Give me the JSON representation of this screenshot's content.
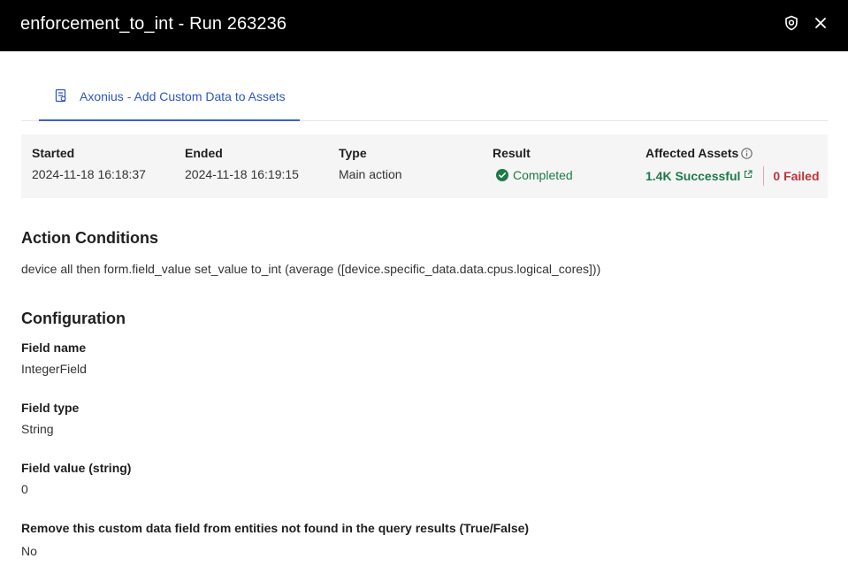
{
  "header": {
    "title": "enforcement_to_int - Run 263236",
    "shield_icon": "shield-icon",
    "close_icon": "close-icon"
  },
  "tabs": [
    {
      "label": "Axonius - Add Custom Data to Assets",
      "icon": "document-icon",
      "active": true
    }
  ],
  "summary": {
    "started_label": "Started",
    "started_value": "2024-11-18 16:18:37",
    "ended_label": "Ended",
    "ended_value": "2024-11-18 16:19:15",
    "type_label": "Type",
    "type_value": "Main action",
    "result_label": "Result",
    "result_value": "Completed",
    "affected_label": "Affected Assets",
    "successful": "1.4K Successful",
    "failed": "0 Failed"
  },
  "action_conditions": {
    "title": "Action Conditions",
    "text": "device all then form.field_value set_value to_int (average ([device.specific_data.data.cpus.logical_cores]))"
  },
  "configuration": {
    "title": "Configuration",
    "fields": [
      {
        "label": "Field name",
        "value": "IntegerField"
      },
      {
        "label": "Field type",
        "value": "String"
      },
      {
        "label": "Field value (string)",
        "value": "0"
      },
      {
        "label": "Remove this custom data field from entities not found in the query results (True/False)",
        "value": "No"
      }
    ]
  },
  "colors": {
    "header_bg": "#000000",
    "accent": "#2f56c0",
    "success": "#1d7a4a",
    "failed": "#c0333a",
    "summary_bg": "#f5f5f5"
  }
}
